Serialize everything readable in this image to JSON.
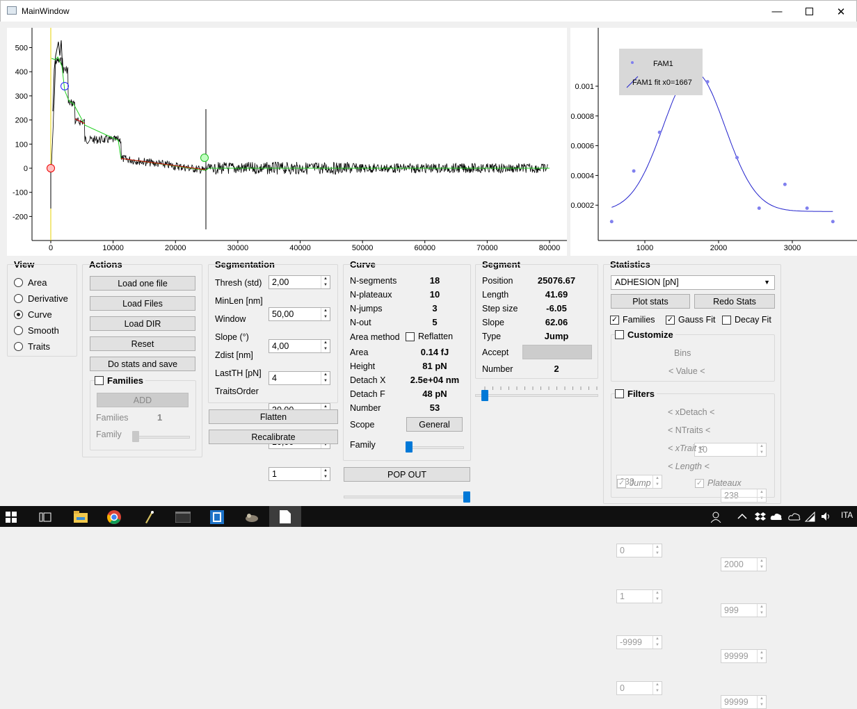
{
  "window": {
    "title": "MainWindow",
    "minimize_icon": "minimize-icon",
    "maximize_icon": "maximize-icon",
    "close_icon": "close-icon"
  },
  "plot_left": {
    "type": "line",
    "y_ticks": [
      "500",
      "400",
      "300",
      "200",
      "100",
      "0",
      "-100",
      "-200"
    ],
    "x_ticks": [
      "0",
      "10000",
      "20000",
      "30000",
      "40000",
      "50000",
      "60000",
      "70000",
      "80000"
    ],
    "xlim": [
      -3000,
      82000
    ],
    "ylim": [
      -300,
      580
    ]
  },
  "plot_right": {
    "type": "scatter",
    "y_ticks": [
      "0.001",
      "0.0008",
      "0.0006",
      "0.0004",
      "0.0002"
    ],
    "x_ticks": [
      "1000",
      "2000",
      "3000"
    ],
    "legend": [
      "FAM1",
      "FAM1 fit x0=1667"
    ]
  },
  "chart_data": [
    {
      "type": "scatter",
      "series": [
        {
          "name": "FAM1",
          "x": [
            550,
            850,
            1200,
            1600,
            1850,
            2250,
            2550,
            2900,
            3200,
            3550
          ],
          "y": [
            9e-05,
            0.00043,
            0.00069,
            0.00103,
            0.00103,
            0.00052,
            0.00018,
            0.00034,
            0.00018,
            9e-05
          ]
        },
        {
          "name": "FAM1 fit x0=1667",
          "x0": 1667
        }
      ],
      "legend": [
        "FAM1",
        "FAM1 fit x0=1667"
      ]
    }
  ],
  "view": {
    "title": "View",
    "options": [
      "Area",
      "Derivative",
      "Curve",
      "Smooth",
      "Traits"
    ],
    "selected": "Curve"
  },
  "actions": {
    "title": "Actions",
    "buttons": [
      "Load one file",
      "Load Files",
      "Load DIR",
      "Reset",
      "Do stats and save"
    ],
    "families_title": "Families",
    "add": "ADD",
    "families_label": "Families",
    "families_value": "1",
    "family_label": "Family"
  },
  "segmentation": {
    "title": "Segmentation",
    "fields": [
      {
        "label": "Thresh (std)",
        "value": "2,00"
      },
      {
        "label": "MinLen [nm]",
        "value": "50,00"
      },
      {
        "label": "Window",
        "value": "4,00"
      },
      {
        "label": "Slope (°)",
        "value": "4"
      },
      {
        "label": "Zdist [nm]",
        "value": "30,00"
      },
      {
        "label": "LastTH [pN]",
        "value": "10,00"
      },
      {
        "label": "TraitsOrder",
        "value": "1"
      }
    ],
    "flatten": "Flatten",
    "recalibrate": "Recalibrate"
  },
  "curve": {
    "title": "Curve",
    "rows": [
      {
        "label": "N-segments",
        "value": "18"
      },
      {
        "label": "N-plateaux",
        "value": "10"
      },
      {
        "label": "N-jumps",
        "value": "3"
      },
      {
        "label": "N-out",
        "value": "5"
      }
    ],
    "area_method": "Area method",
    "reflatten": "Reflatten",
    "rows2": [
      {
        "label": "Area",
        "value": "0.14 fJ"
      },
      {
        "label": "Height",
        "value": "81 pN"
      },
      {
        "label": "Detach X",
        "value": "2.5e+04 nm"
      },
      {
        "label": "Detach F",
        "value": "48 pN"
      },
      {
        "label": "Number",
        "value": "53"
      }
    ],
    "scope": "Scope",
    "general": "General",
    "family": "Family",
    "popout": "POP OUT"
  },
  "segment": {
    "title": "Segment",
    "rows": [
      {
        "label": "Position",
        "value": "25076.67"
      },
      {
        "label": "Length",
        "value": "41.69"
      },
      {
        "label": "Step size",
        "value": "-6.05"
      },
      {
        "label": "Slope",
        "value": "62.06"
      },
      {
        "label": "Type",
        "value": "Jump"
      }
    ],
    "accept": "Accept",
    "number_label": "Number",
    "number_value": "2"
  },
  "statistics": {
    "title": "Statistics",
    "combo": "ADHESION [pN]",
    "plot_stats": "Plot stats",
    "redo_stats": "Redo Stats",
    "families": "Families",
    "gauss_fit": "Gauss Fit",
    "decay_fit": "Decay Fit",
    "customize": "Customize",
    "bins_label": "Bins",
    "bins_value": "10",
    "value_label": "< Value <",
    "value_min": "238",
    "value_max": "238",
    "filters": "Filters",
    "filter_rows": [
      {
        "min": "0",
        "label": "< xDetach <",
        "max": "2000"
      },
      {
        "min": "1",
        "label": "< NTraits <",
        "max": "999"
      },
      {
        "min": "-9999",
        "label": "< xTrait <",
        "max": "99999"
      },
      {
        "min": "0",
        "label": "< Length <",
        "max": "99999"
      }
    ],
    "jump": "Jump",
    "plateaux": "Plateaux"
  },
  "taskbar": {
    "lang": "ITA"
  }
}
